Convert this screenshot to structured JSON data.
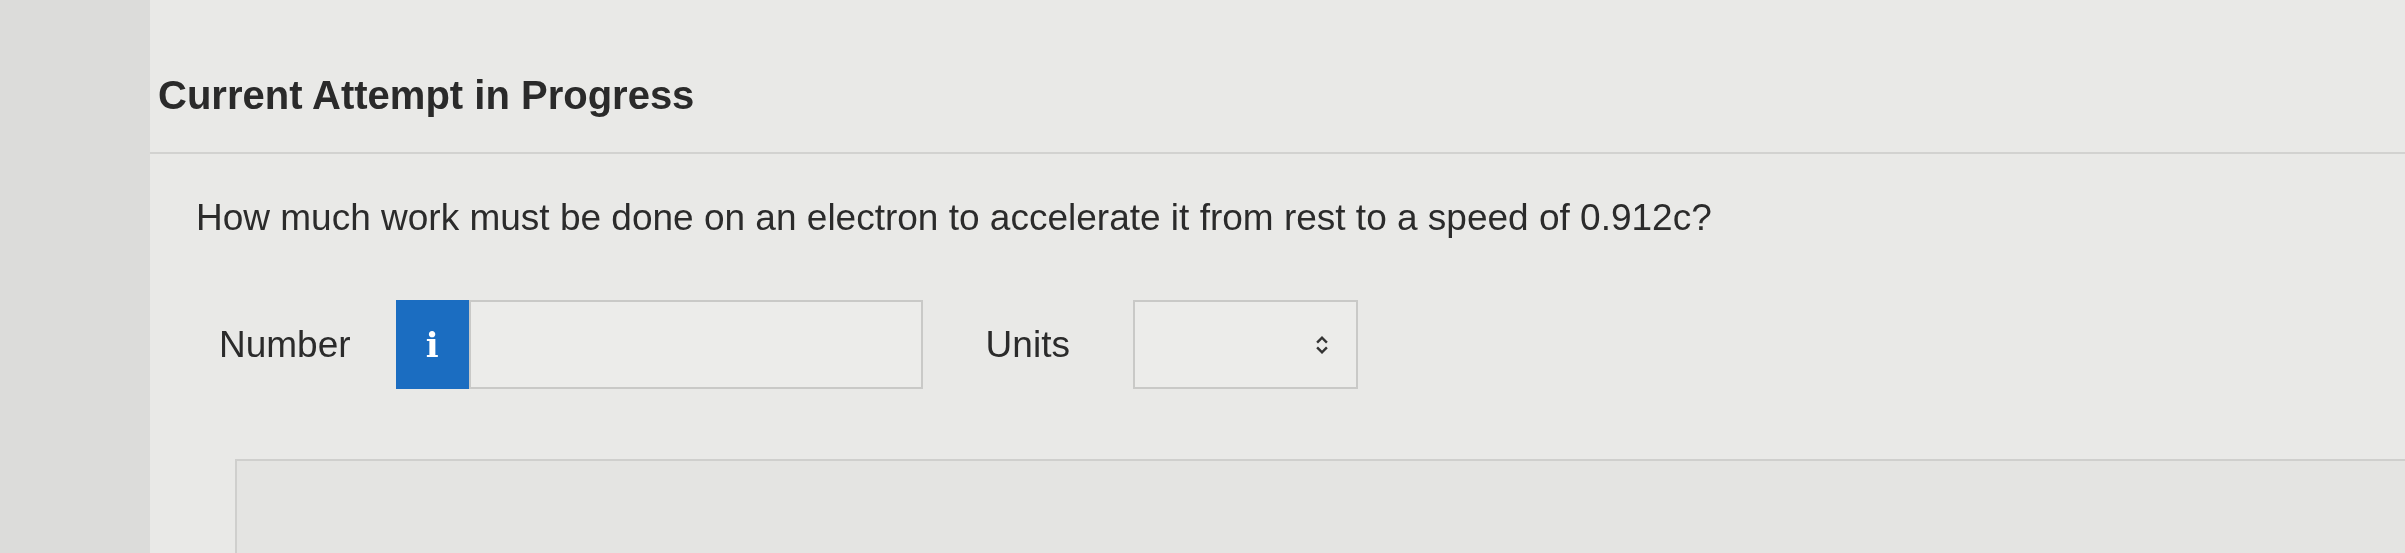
{
  "heading": "Current Attempt in Progress",
  "question": "How much work must be done on an electron to accelerate it from rest to a speed of 0.912c?",
  "answer": {
    "number_label": "Number",
    "info_icon": "i",
    "units_label": "Units"
  }
}
